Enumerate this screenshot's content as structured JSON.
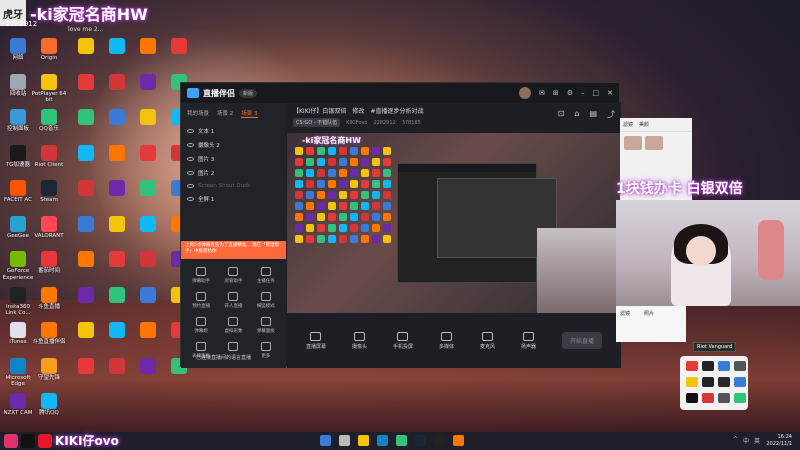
{
  "overlay": {
    "logo_mark": "虎牙",
    "streamer_name": "-ki家冠名商HW",
    "room_id": "2282912",
    "top_text": "love me 2...",
    "promo_text": "1块钱办卡 白银双倍",
    "social_text": "KIKI仔ovo"
  },
  "desktop_icons": [
    {
      "label": "网络",
      "color": "#3b7bd8"
    },
    {
      "label": "回收站",
      "color": "#a0a8b3"
    },
    {
      "label": "控制面板",
      "color": "#3a9ad9"
    },
    {
      "label": "TG加速器",
      "color": "#1a1a1a"
    },
    {
      "label": "FACEIT AC",
      "color": "#ff5500"
    },
    {
      "label": "GeeGee",
      "color": "#2aa0d0"
    },
    {
      "label": "GeForce Experience",
      "color": "#76b900"
    },
    {
      "label": "Insta360 Link Co...",
      "color": "#222"
    },
    {
      "label": "iTunes",
      "color": "#e0e0f0"
    },
    {
      "label": "Microsoft Edge",
      "color": "#0f84c9"
    },
    {
      "label": "NZXT CAM",
      "color": "#6d2aa8"
    },
    {
      "label": "Origin",
      "color": "#f56c2d"
    },
    {
      "label": "PotPlayer 64 bit",
      "color": "#f4c30b"
    },
    {
      "label": "QQ音乐",
      "color": "#31c27c"
    },
    {
      "label": "Riot Client",
      "color": "#d13639"
    },
    {
      "label": "Steam",
      "color": "#1b2838"
    },
    {
      "label": "VALORANT",
      "color": "#ff4655"
    },
    {
      "label": "番茄时间",
      "color": "#e5393a"
    },
    {
      "label": "斗鱼直播",
      "color": "#ff7700"
    },
    {
      "label": "斗鱼直播伴侣",
      "color": "#ff7700"
    },
    {
      "label": "守望先锋",
      "color": "#f99e1a"
    },
    {
      "label": "腾讯QQ",
      "color": "#12b7f5"
    }
  ],
  "stream_window": {
    "app_name": "直播伴侣",
    "version_pill": "新版",
    "tabs": [
      "我的场景",
      "场景 2",
      "场景 3"
    ],
    "active_tab_index": 2,
    "scenes": [
      {
        "label": "文本 1",
        "dim": false
      },
      {
        "label": "摄像头 2",
        "dim": false
      },
      {
        "label": "图片 3",
        "dim": false
      },
      {
        "label": "图片 2",
        "dim": false
      },
      {
        "label": "Screen Shout Duck",
        "dim": true
      },
      {
        "label": "全屏 1",
        "dim": false
      }
    ],
    "banner_text": "上周5点弹幕有些为了直播精准... 现在「管理帮手」中推荐给你",
    "tools": [
      "弹幕助手",
      "房管助手",
      "主播任务",
      "预约直播",
      "开人直播",
      "横竖模式",
      "弹幕姬",
      "虚拟形象",
      "弹幕面板",
      "表情面板",
      "",
      "更多"
    ],
    "room_title": "【KIKI仔】白银双倍",
    "room_tags": [
      "修改",
      "#直播逐步分析对战"
    ],
    "game_tag": "CS:GO - 不错队伍",
    "streamer": "KIKIFovo",
    "stats": [
      "2282912",
      "378185"
    ],
    "bottom_buttons": [
      "直播屏幕",
      "摄像头",
      "手机投屏",
      "多媒体",
      "麦克风",
      "扬声器"
    ],
    "start_button": "开始直播",
    "footer_note": "已连接直播间的语言直播"
  },
  "chat_panel": {
    "tabs": [
      "滤镜",
      "美颜"
    ],
    "items": [
      "滤镜",
      "照片"
    ]
  },
  "tooltip": "Riot Vanguard",
  "taskbar": {
    "time": "16:24",
    "date": "2022/11/1",
    "tray": [
      "^",
      "中",
      "英"
    ]
  }
}
